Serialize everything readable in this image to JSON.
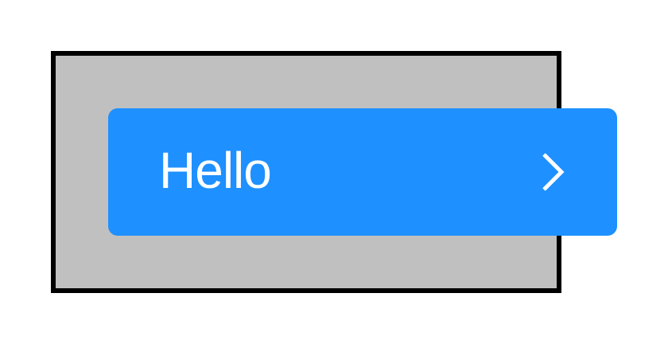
{
  "button": {
    "label": "Hello",
    "icon": "chevron-right-icon",
    "background_color": "#1e90ff",
    "text_color": "#ffffff"
  },
  "container": {
    "fill_color": "#c0c0c0",
    "border_color": "#000000"
  }
}
